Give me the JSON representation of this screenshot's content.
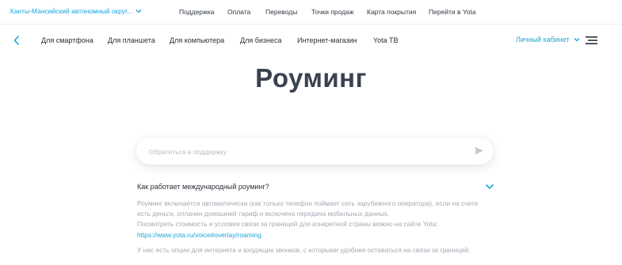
{
  "topbar": {
    "region": "Ханты-Мансийский автономный округ...",
    "links": [
      "Поддержка",
      "Оплата",
      "Переводы",
      "Точки продаж",
      "Карта покрытия",
      "Перейти в Yota"
    ]
  },
  "nav": {
    "items": [
      "Для смартфона",
      "Для планшета",
      "Для компьютера",
      "Для бизнеса",
      "Интернет-магазин",
      "Yota TB"
    ],
    "account": "Личный кабинет"
  },
  "page": {
    "title": "Роуминг"
  },
  "search": {
    "placeholder": "Обратиться в поддержку",
    "value": ""
  },
  "faq": {
    "question": "Как работает международный роуминг?",
    "answer_line1": "Роуминг включается автоматически (как только телефон поймает сеть зарубежного оператора), если на счете",
    "answer_line2": "есть деньги, оплачен домашний тариф и включена передача мобильных данных.",
    "answer_line3": "Посмотреть стоимость и условия связи за границей для конкретной страны можно на сайте Yota:",
    "answer_link": "https://www.yota.ru/voice#overlay/roaming",
    "answer_more": "У нас есть опции для интернета и входящих звонков, с которыми удобнее оставаться на связи за границей."
  },
  "colors": {
    "accent": "#1ca4d9",
    "title": "#3a4150",
    "muted": "#a4a9b2"
  },
  "icons": {
    "region": "chevron-down-icon",
    "back": "chevron-left-icon",
    "account": "chevron-down-icon",
    "menu": "hamburger-menu-icon",
    "send": "send-arrow-icon",
    "faq": "chevron-down-icon"
  }
}
